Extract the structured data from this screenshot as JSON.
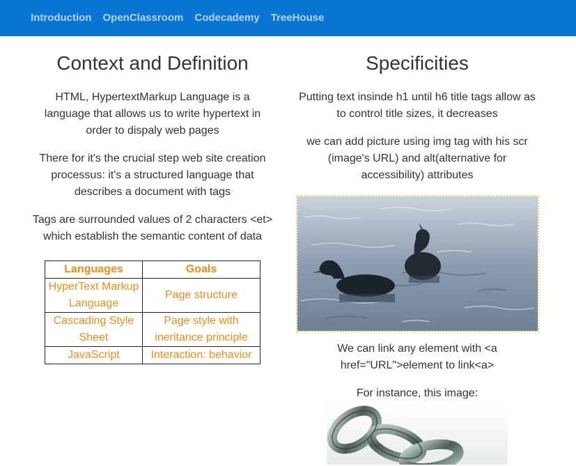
{
  "nav": {
    "links": [
      "Introduction",
      "OpenClassroom",
      "Codecademy",
      "TreeHouse"
    ]
  },
  "left": {
    "title": "Context and Definition",
    "paragraphs": [
      "HTML, HypertextMarkup Language is a language that allows us to write hypertext in order to dispaly web pages",
      "There for it's the crucial step web site creation processus: it's a structured language that describes a document with tags",
      "Tags are surrounded values of 2 characters <et> which establish the semantic content of data"
    ],
    "table": {
      "headers": [
        "Languages",
        "Goals"
      ],
      "rows": [
        [
          "HyperText Markup Language",
          "Page structure"
        ],
        [
          "Cascading Style Sheet",
          "Page style with ineritance principle"
        ],
        [
          "JavaScript",
          "Interaction: behavior"
        ]
      ]
    }
  },
  "right": {
    "title": "Specificities",
    "paragraphs": [
      "Putting text insinde h1 until h6 title tags allow as to control title sizes, it decreases",
      "we can add picture using img tag with his scr (image's URL) and alt(alternative for accessibility) attributes"
    ],
    "link_caption": "We can link any element with <a href=\"URL\">element to link<a>",
    "instance_caption": "For instance, this image:"
  },
  "colors": {
    "navbar": "#0874d4",
    "nav_link": "#b7d4f1",
    "table_text": "#ef8d17",
    "image_border": "#e9d96a"
  }
}
